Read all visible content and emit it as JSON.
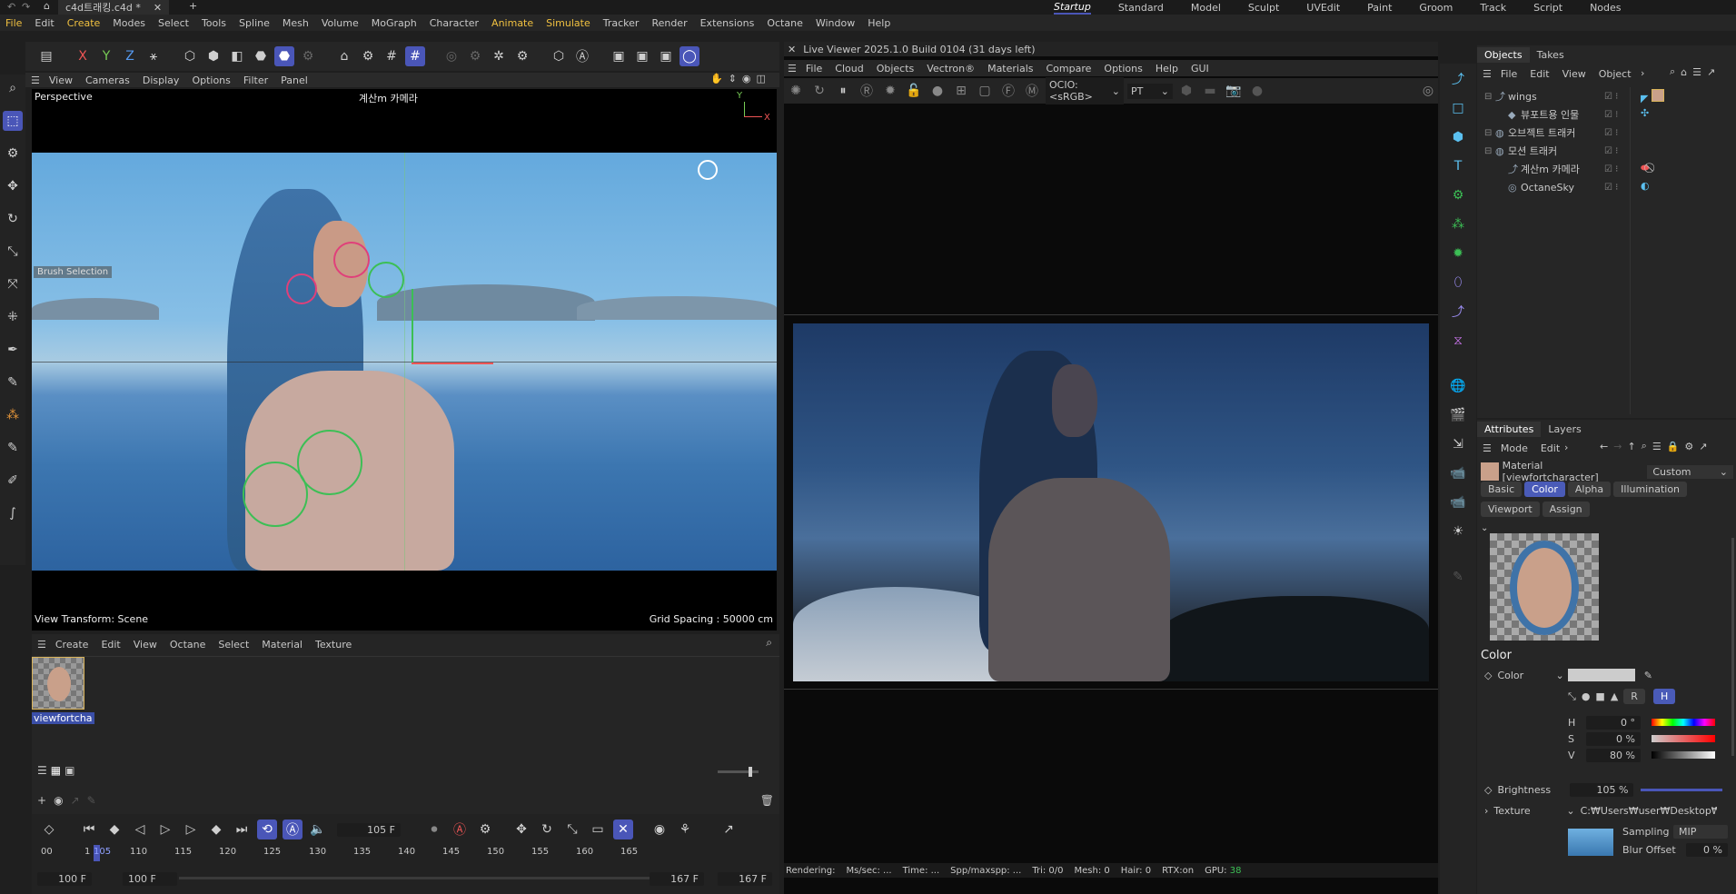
{
  "title_bar": {
    "file_tab": "c4d트래킹.c4d *",
    "layouts": [
      "Startup",
      "Standard",
      "Model",
      "Sculpt",
      "UVEdit",
      "Paint",
      "Groom",
      "Track",
      "Script",
      "Nodes"
    ]
  },
  "menu": [
    "File",
    "Edit",
    "Create",
    "Modes",
    "Select",
    "Tools",
    "Spline",
    "Mesh",
    "Volume",
    "MoGraph",
    "Character",
    "Animate",
    "Simulate",
    "Tracker",
    "Render",
    "Extensions",
    "Octane",
    "Window",
    "Help"
  ],
  "toolbar": {
    "x": "X",
    "y": "Y",
    "z": "Z"
  },
  "viewport_menu": [
    "View",
    "Cameras",
    "Display",
    "Options",
    "Filter",
    "Panel"
  ],
  "viewport": {
    "name": "Perspective",
    "camera": "계산m 카메라",
    "brush_label": "Brush Selection",
    "view_transform": "View Transform: Scene",
    "grid_spacing": "Grid Spacing : 50000 cm",
    "axis_y": "Y",
    "axis_x": "X"
  },
  "material_manager": {
    "menu": [
      "Create",
      "Edit",
      "View",
      "Octane",
      "Select",
      "Material",
      "Texture"
    ],
    "material_name": "viewfortcha"
  },
  "timeline": {
    "current_frame": "105 F",
    "ticks": [
      "00",
      "1",
      "105",
      "110",
      "115",
      "120",
      "125",
      "130",
      "135",
      "140",
      "145",
      "150",
      "155",
      "160",
      "165"
    ],
    "start_a": "100 F",
    "start_b": "100 F",
    "end_a": "167 F",
    "end_b": "167 F"
  },
  "live_viewer": {
    "title": "Live Viewer 2025.1.0 Build 0104 (31 days left)",
    "menu": [
      "File",
      "Cloud",
      "Objects",
      "Vectron®",
      "Materials",
      "Compare",
      "Options",
      "Help",
      "GUI"
    ],
    "ocio": "OCIO:<sRGB>",
    "mode": "PT",
    "status": {
      "rendering": "Rendering:",
      "ms": "Ms/sec: ...",
      "time": "Time: ...",
      "spp": "Spp/maxspp: ...",
      "tri": "Tri: 0/0",
      "mesh": "Mesh: 0",
      "hair": "Hair: 0",
      "rtx": "RTX:on",
      "gpu": "GPU:",
      "gpu_val": "38"
    }
  },
  "objects_panel": {
    "tabs": [
      "Objects",
      "Takes"
    ],
    "menu": [
      "File",
      "Edit",
      "View",
      "Object"
    ],
    "items": [
      {
        "name": "wings",
        "indent": 0
      },
      {
        "name": "뷰포트용 인물",
        "indent": 1
      },
      {
        "name": "오브젝트 트래커",
        "indent": 0
      },
      {
        "name": "모션 트래커",
        "indent": 0
      },
      {
        "name": "계산m 카메라",
        "indent": 1
      },
      {
        "name": "OctaneSky",
        "indent": 1
      }
    ]
  },
  "attributes_panel": {
    "tabs": [
      "Attributes",
      "Layers"
    ],
    "menu": [
      "Mode",
      "Edit"
    ],
    "material": "Material [viewfortcharacter]",
    "preset": "Custom",
    "subtabs": [
      "Basic",
      "Color",
      "Alpha",
      "Illumination"
    ],
    "subtabs2": [
      "Viewport",
      "Assign"
    ],
    "section": "Color",
    "color_label": "Color",
    "h_label": "H",
    "h_value": "0 °",
    "s_label": "S",
    "s_value": "0 %",
    "v_label": "V",
    "v_value": "80 %",
    "brightness_label": "Brightness",
    "brightness_value": "105 %",
    "texture_label": "Texture",
    "texture_path": "C:₩Users₩user₩Desktop₩...",
    "sampling_label": "Sampling",
    "sampling_value": "MIP",
    "blur_label": "Blur Offset",
    "blur_value": "0 %"
  },
  "colors": {
    "accent": "#4a56b8",
    "highlight": "#f0c040",
    "green": "#3cbf55"
  }
}
